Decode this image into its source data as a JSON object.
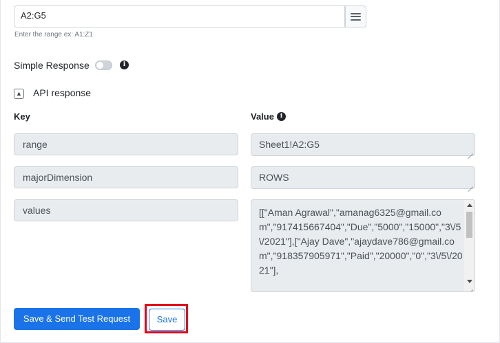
{
  "range": {
    "value": "A2:G5",
    "hint": "Enter the range ex: A1:Z1",
    "menu_icon": "hamburger-menu-icon"
  },
  "simple_response": {
    "label": "Simple Response",
    "enabled": false,
    "info_icon": "info-circle-icon"
  },
  "api_response": {
    "label": "API response",
    "collapse_icon": "chevron-up-icon"
  },
  "table": {
    "key_header": "Key",
    "value_header": "Value",
    "rows": [
      {
        "key": "range",
        "value": "Sheet1!A2:G5"
      },
      {
        "key": "majorDimension",
        "value": "ROWS"
      },
      {
        "key": "values",
        "value": "[[\"Aman Agrawal\",\"amanag6325@gmail.com\",\"917415667404\",\"Due\",\"5000\",\"15000\",\"3\\/5\\/2021\"],[\"Ajay Dave\",\"ajaydave786@gmail.com\",\"918357905971\",\"Paid\",\"20000\",\"0\",\"3\\/5\\/2021\"],"
      }
    ]
  },
  "actions": {
    "save_send_label": "Save & Send Test Request",
    "save_label": "Save"
  },
  "colors": {
    "primary": "#1a73e8",
    "highlight": "#e2001a",
    "readonly_bg": "#e9ecef"
  }
}
